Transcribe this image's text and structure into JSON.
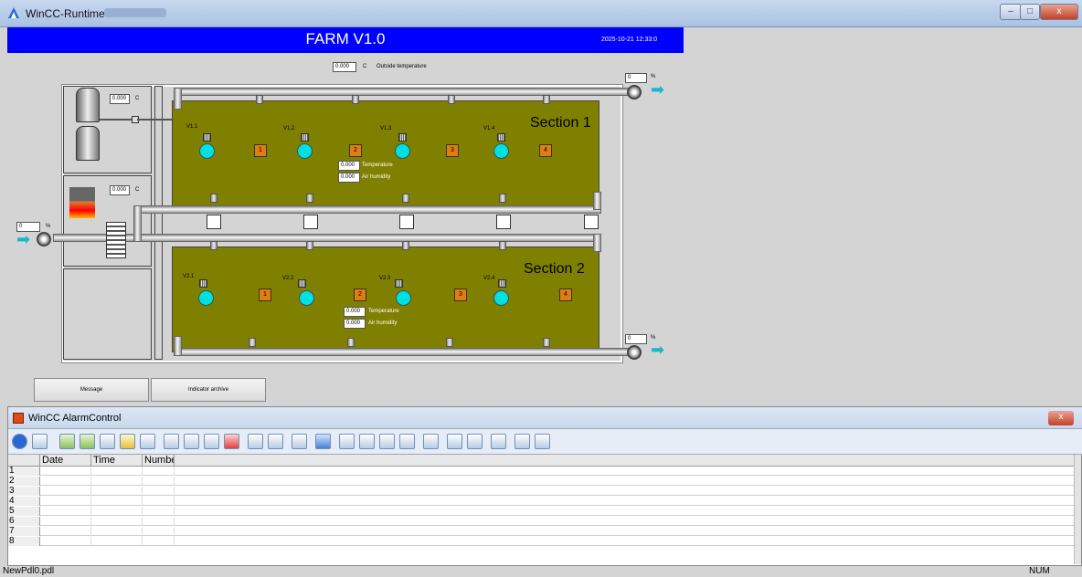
{
  "window": {
    "title": "WinCC-Runtime -",
    "close_label": "x",
    "min_label": "–",
    "max_label": "□"
  },
  "header": {
    "app_title": "FARM V1.0",
    "datetime": "2025-10-21 12:33:0"
  },
  "outside": {
    "value": "0.000",
    "unit": "C",
    "label": "Outside temperature"
  },
  "tanks": {
    "value": "0.000",
    "unit": "C"
  },
  "heater": {
    "value": "0.000",
    "unit": "C"
  },
  "inlet_fan": {
    "value": "0",
    "unit": "%"
  },
  "exhaust_fan_1": {
    "value": "0",
    "unit": "%"
  },
  "exhaust_fan_2": {
    "value": "0",
    "unit": "%"
  },
  "section1": {
    "title": "Section 1",
    "valves": [
      "V1.1",
      "V1.2",
      "V1.3",
      "V1.4"
    ],
    "numbers": [
      "1",
      "2",
      "3",
      "4"
    ],
    "temperature": "0.000",
    "temperature_label": "Temperature",
    "humidity": "0.000",
    "humidity_label": "Air humidity"
  },
  "section2": {
    "title": "Section 2",
    "valves": [
      "V2.1",
      "V2.2",
      "V2.3",
      "V2.4"
    ],
    "numbers": [
      "1",
      "2",
      "3",
      "4"
    ],
    "temperature": "0.000",
    "temperature_label": "Temperature",
    "humidity": "0.000",
    "humidity_label": "Air humidity"
  },
  "buttons": {
    "message": "Message",
    "indicator_archive": "Indicator archive"
  },
  "alarm": {
    "title": "WinCC AlarmControl",
    "close_label": "x",
    "columns": [
      "Date",
      "Time",
      "Numbe"
    ],
    "rows": [
      "1",
      "2",
      "3",
      "4",
      "5",
      "6",
      "7",
      "8"
    ]
  },
  "statusbar": {
    "left": "NewPdl0.pdl",
    "right": "NUM"
  },
  "colors": {
    "header": "#0000ff",
    "section": "#808000",
    "lamp": "#00e0e0",
    "number": "#e07d10"
  }
}
